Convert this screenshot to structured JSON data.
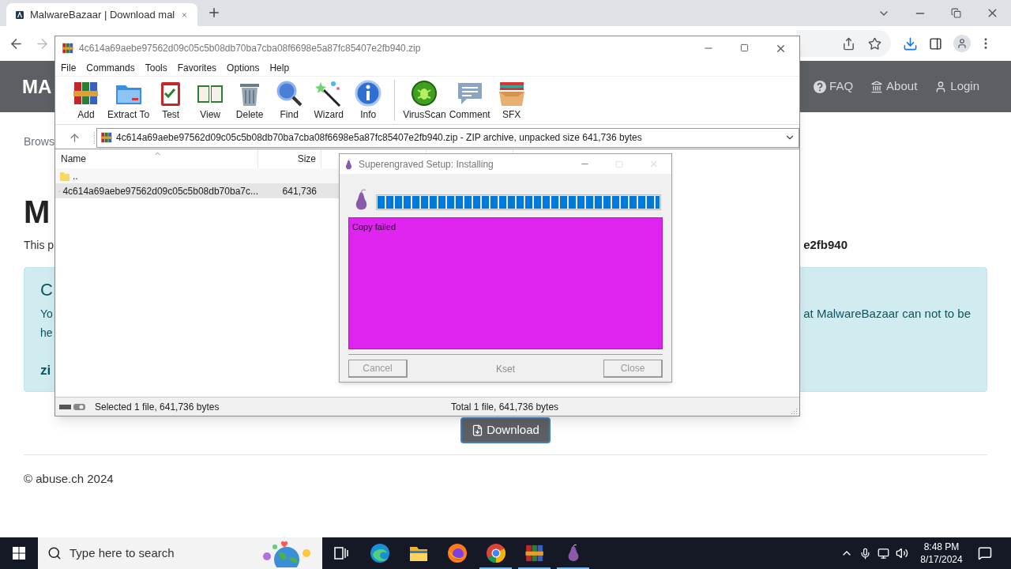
{
  "browser": {
    "tab_title": "MalwareBazaar | Download mal"
  },
  "site": {
    "brand": "MA",
    "nav": [
      {
        "label": "FAQ",
        "kind": "faq"
      },
      {
        "label": "About",
        "kind": "about"
      },
      {
        "label": "Login",
        "kind": "login"
      }
    ],
    "breadcrumb": "Brows",
    "heading": "M",
    "intro_left": "This p",
    "intro_right": "e2fb940",
    "alert": {
      "heading": "C",
      "line_1_left": "Yo",
      "line_1_right": "at MalwareBazaar can not to be",
      "line_2_left": "he",
      "password_label": "zi"
    },
    "download_button": "Download",
    "footer": "© abuse.ch 2024"
  },
  "winrar": {
    "title": "4c614a69aebe97562d09c05c5b08db70ba7cba08f6698e5a87fc85407e2fb940.zip",
    "menu": [
      "File",
      "Commands",
      "Tools",
      "Favorites",
      "Options",
      "Help"
    ],
    "toolbar": [
      {
        "label": "Add",
        "kind": "add"
      },
      {
        "label": "Extract To",
        "kind": "extract"
      },
      {
        "label": "Test",
        "kind": "test"
      },
      {
        "label": "View",
        "kind": "view"
      },
      {
        "label": "Delete",
        "kind": "delete"
      },
      {
        "label": "Find",
        "kind": "find"
      },
      {
        "label": "Wizard",
        "kind": "wizard"
      },
      {
        "label": "Info",
        "kind": "info"
      },
      {
        "label": "VirusScan",
        "kind": "virusscan"
      },
      {
        "label": "Comment",
        "kind": "comment"
      },
      {
        "label": "SFX",
        "kind": "sfx"
      }
    ],
    "path": "4c614a69aebe97562d09c05c5b08db70ba7cba08f6698e5a87fc85407e2fb940.zip - ZIP archive, unpacked size 641,736 bytes",
    "columns": [
      "Name",
      "Size"
    ],
    "rows": [
      {
        "kind": "parent",
        "name": "..",
        "selected": false
      },
      {
        "kind": "file",
        "name": "4c614a69aebe97562d09c05c5b08db70ba7c...",
        "size": "641,736",
        "selected": true
      }
    ],
    "status_left": "Selected 1 file, 641,736 bytes",
    "status_right": "Total 1 file, 641,736 bytes"
  },
  "setup": {
    "title": "Superengraved Setup: Installing",
    "progress": {
      "level": 1
    },
    "log": [
      "Copy failed"
    ],
    "buttons": [
      {
        "label": "Cancel",
        "disabled": true
      },
      {
        "label": "Close",
        "disabled": true
      }
    ],
    "brand": "Kset"
  },
  "taskbar": {
    "search_placeholder": "Type here to search",
    "apps": [
      {
        "kind": "edge",
        "running": false
      },
      {
        "kind": "explorer",
        "running": false
      },
      {
        "kind": "firefox",
        "running": false
      },
      {
        "kind": "chrome",
        "running": true
      },
      {
        "kind": "winrar",
        "running": true
      },
      {
        "kind": "pear",
        "running": true
      }
    ],
    "time": "8:48 PM",
    "date": "8/17/2024"
  }
}
